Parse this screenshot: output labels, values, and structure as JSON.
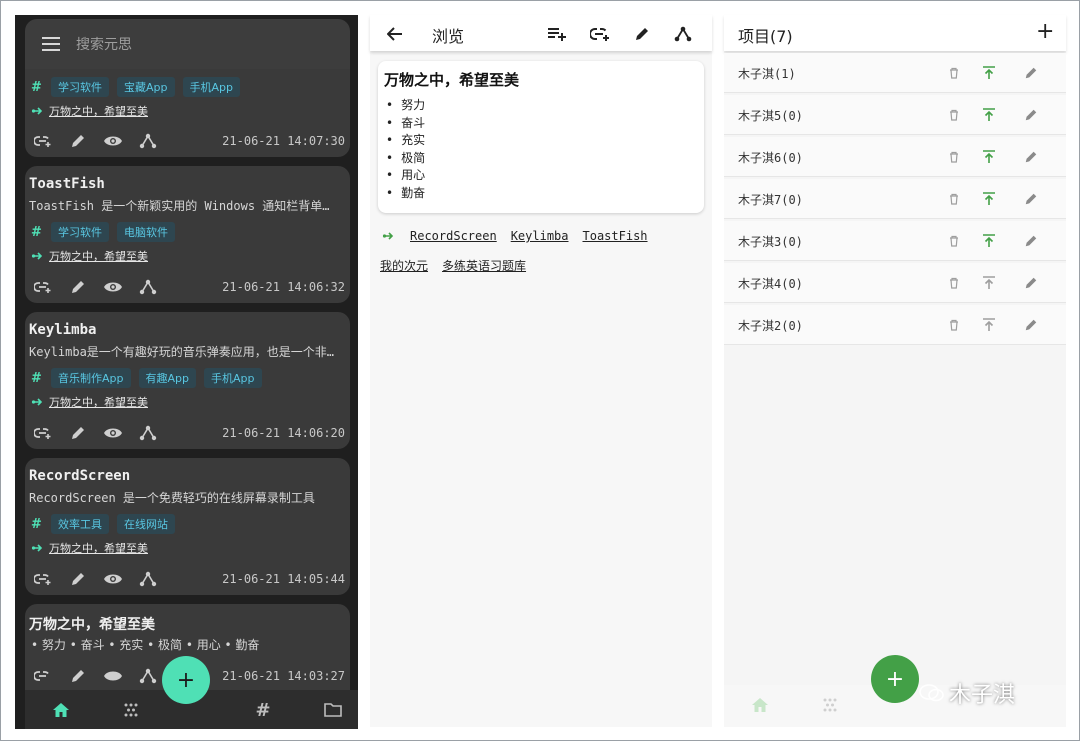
{
  "colors": {
    "accent": "#4fe0b5",
    "tag_text": "#59c7e2",
    "green": "#43a047",
    "dark_bg": "#1f1f1f",
    "card_bg": "#3a3a3a"
  },
  "left": {
    "search_placeholder": "搜索元思",
    "cards": [
      {
        "title": "",
        "desc": "",
        "tags": [
          "学习软件",
          "宝藏App",
          "手机App"
        ],
        "link": "万物之中，希望至美",
        "time": "21-06-21 14:07:30"
      },
      {
        "title": "ToastFish",
        "desc": "ToastFish 是一个新颖实用的 Windows 通知栏背单…",
        "tags": [
          "学习软件",
          "电脑软件"
        ],
        "link": "万物之中，希望至美",
        "time": "21-06-21 14:06:32"
      },
      {
        "title": "Keylimba",
        "desc": "Keylimba是一个有趣好玩的音乐弹奏应用，也是一个非…",
        "tags": [
          "音乐制作App",
          "有趣App",
          "手机App"
        ],
        "link": "万物之中，希望至美",
        "time": "21-06-21 14:06:20"
      },
      {
        "title": "RecordScreen",
        "desc": "RecordScreen 是一个免费轻巧的在线屏幕录制工具",
        "tags": [
          "效率工具",
          "在线网站"
        ],
        "link": "万物之中，希望至美",
        "time": "21-06-21 14:05:44"
      },
      {
        "title": "万物之中，希望至美",
        "bullets": "• 努力 • 奋斗 • 充实 • 极简 • 用心 • 勤奋",
        "time": "21-06-21 14:03:27"
      }
    ],
    "fab_label": "+"
  },
  "middle": {
    "title": "浏览",
    "note_title": "万物之中，希望至美",
    "items": [
      "努力",
      "奋斗",
      "充实",
      "极简",
      "用心",
      "勤奋"
    ],
    "related": [
      "RecordScreen",
      "Keylimba",
      "ToastFish"
    ],
    "related2": [
      "我的次元",
      "多练英语习题库"
    ]
  },
  "right": {
    "title": "项目(7)",
    "add_label": "+",
    "rows": [
      {
        "label": "木子淇(1)",
        "pinned": true
      },
      {
        "label": "木子淇5(0)",
        "pinned": true
      },
      {
        "label": "木子淇6(0)",
        "pinned": true
      },
      {
        "label": "木子淇7(0)",
        "pinned": true
      },
      {
        "label": "木子淇3(0)",
        "pinned": true
      },
      {
        "label": "木子淇4(0)",
        "pinned": false
      },
      {
        "label": "木子淇2(0)",
        "pinned": false
      }
    ],
    "fab_label": "+",
    "watermark": "木子淇"
  }
}
